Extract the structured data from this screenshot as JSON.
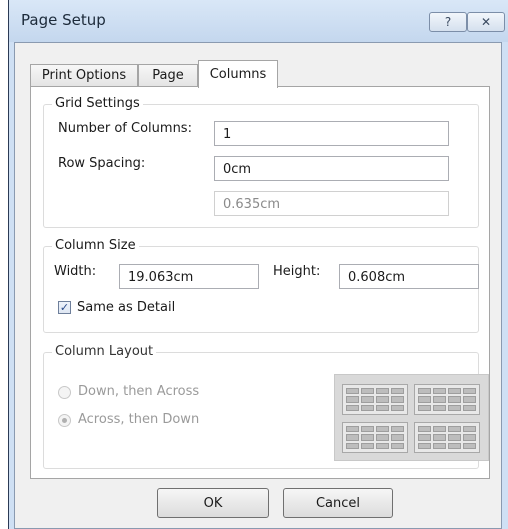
{
  "window": {
    "title": "Page Setup",
    "help_glyph": "?",
    "close_glyph": "✕"
  },
  "tabs": [
    {
      "label": "Print Options"
    },
    {
      "label": "Page"
    },
    {
      "label": "Columns",
      "active": true
    }
  ],
  "grid_settings": {
    "legend": "Grid Settings",
    "number_of_columns_label": "Number of Columns:",
    "number_of_columns_value": "1",
    "row_spacing_label": "Row Spacing:",
    "row_spacing_value": "0cm",
    "row_spacing_secondary_value": "0.635cm"
  },
  "column_size": {
    "legend": "Column Size",
    "width_label": "Width:",
    "width_value": "19.063cm",
    "height_label": "Height:",
    "height_value": "0.608cm",
    "same_as_detail_label": "Same as Detail",
    "same_as_detail_checked": true
  },
  "column_layout": {
    "legend": "Column Layout",
    "options": [
      {
        "label": "Down, then Across",
        "selected": false
      },
      {
        "label": "Across, then Down",
        "selected": true
      }
    ]
  },
  "buttons": {
    "ok": "OK",
    "cancel": "Cancel"
  }
}
